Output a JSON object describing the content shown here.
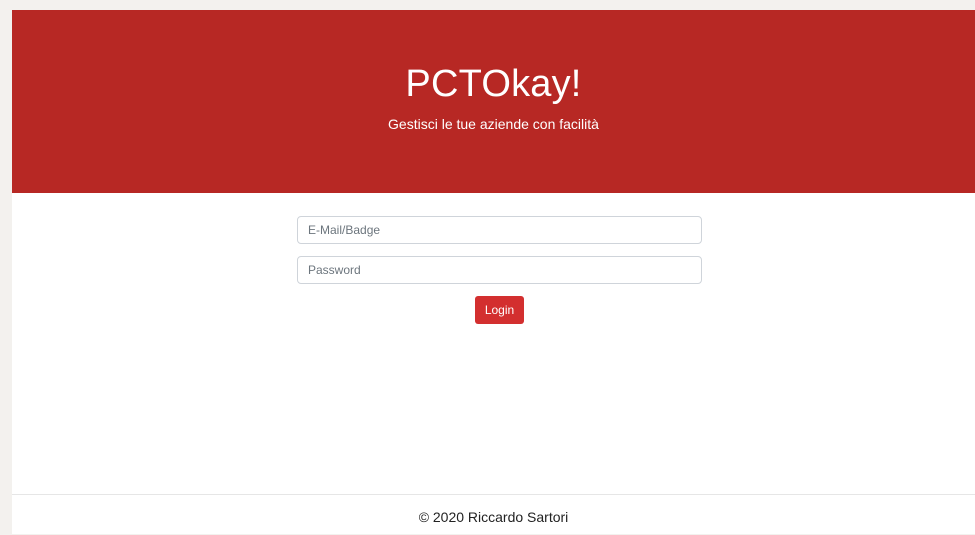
{
  "header": {
    "title": "PCTOkay!",
    "subtitle": "Gestisci le tue aziende con facilità"
  },
  "login_form": {
    "email_placeholder": "E-Mail/Badge",
    "email_value": "",
    "password_placeholder": "Password",
    "password_value": "",
    "login_label": "Login"
  },
  "footer": {
    "copyright": "© 2020 Riccardo Sartori"
  },
  "colors": {
    "hero_background": "#b72824",
    "button_background": "#d32f2f",
    "page_background": "#ffffff",
    "outer_background": "#f3f1ee"
  }
}
